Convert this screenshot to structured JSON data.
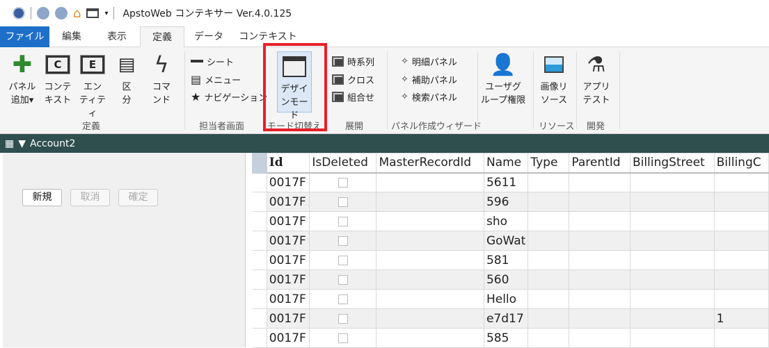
{
  "app": {
    "title": "ApstoWeb コンテキサー Ver.4.0.125"
  },
  "tabs": [
    {
      "label": "ファイル"
    },
    {
      "label": "編集"
    },
    {
      "label": "表示"
    },
    {
      "label": "定義"
    },
    {
      "label": "データ"
    },
    {
      "label": "コンテキスト"
    }
  ],
  "ribbon": {
    "def_group": "定義",
    "panel_add": [
      "パネル",
      "追加"
    ],
    "context": [
      "コンテ",
      "キスト"
    ],
    "entity": [
      "エン",
      "ティティ"
    ],
    "division": [
      "区",
      "分"
    ],
    "command": [
      "コマ",
      "ンド"
    ],
    "staff_group": "担当者画面",
    "sheet": "シート",
    "menu": "メニュー",
    "navigation": "ナビゲーション",
    "mode_group": "モード切替え",
    "design_mode": [
      "デザイ",
      "ンモード"
    ],
    "expand_group": "展開",
    "timeseries": "時系列",
    "cross": "クロス",
    "combo": "組合せ",
    "wizard_group": "パネル作成ウィザード",
    "detail_panel": "明細パネル",
    "aux_panel": "補助パネル",
    "search_panel": "検索パネル",
    "user_group_perm": [
      "ユーザグ",
      "ループ権限"
    ],
    "image_resource": [
      "画像リ",
      "ソース"
    ],
    "resource_group": "リソース",
    "app_test": [
      "アプリ",
      "テスト"
    ],
    "dev_group": "開発"
  },
  "panel": {
    "title": "Account2",
    "new": "新規",
    "cancel": "取消",
    "confirm": "確定"
  },
  "grid": {
    "columns": [
      "Id",
      "IsDeleted",
      "MasterRecordId",
      "Name",
      "Type",
      "ParentId",
      "BillingStreet",
      "BillingC"
    ],
    "rows": [
      {
        "id": "0017F",
        "name": "5611",
        "billing": ""
      },
      {
        "id": "0017F",
        "name": "596",
        "billing": ""
      },
      {
        "id": "0017F",
        "name": "sho",
        "billing": ""
      },
      {
        "id": "0017F",
        "name": "GoWat",
        "billing": ""
      },
      {
        "id": "0017F",
        "name": "581",
        "billing": ""
      },
      {
        "id": "0017F",
        "name": "560",
        "billing": ""
      },
      {
        "id": "0017F",
        "name": "Hello",
        "billing": ""
      },
      {
        "id": "0017F",
        "name": "e7d17",
        "billing": "1"
      },
      {
        "id": "0017F",
        "name": "585",
        "billing": ""
      }
    ]
  },
  "colors": {
    "file_tab": "#1e6fc9",
    "dark_bar": "#2f4f4f",
    "highlight": "#e8202a"
  }
}
